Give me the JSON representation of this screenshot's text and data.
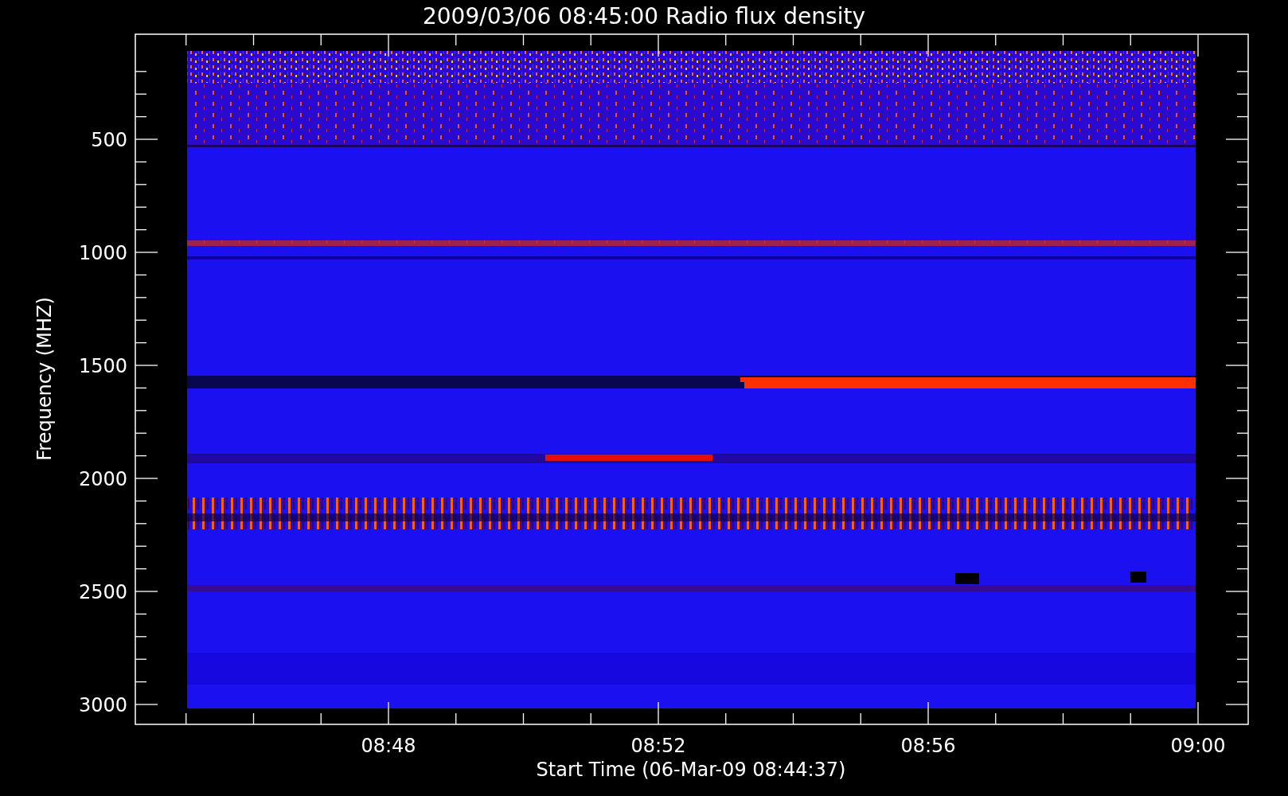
{
  "title": "2009/03/06 08:45:00 Radio flux density",
  "y_axis": {
    "label": "Frequency (MHZ)",
    "ticks": [
      "500",
      "1000",
      "1500",
      "2000",
      "2500",
      "3000"
    ]
  },
  "x_axis": {
    "label": "Start Time (06-Mar-09 08:44:37)",
    "ticks": [
      "08:48",
      "08:52",
      "08:56",
      "09:00"
    ]
  }
}
